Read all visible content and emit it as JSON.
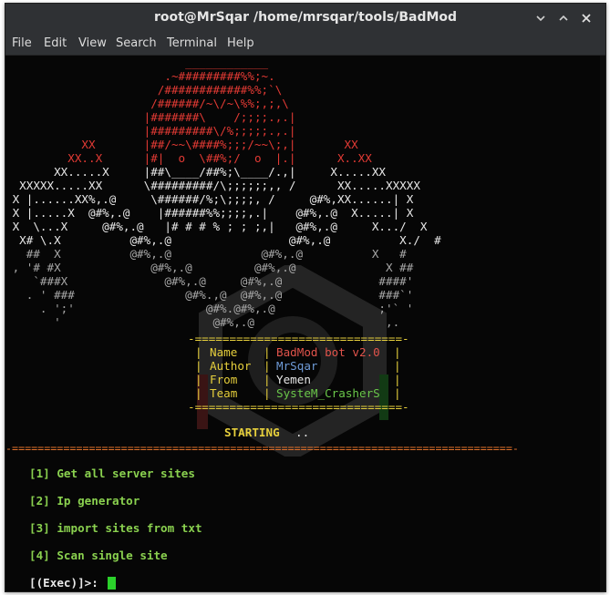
{
  "window": {
    "title": "root@MrSqar /home/mrsqar/tools/BadMod"
  },
  "menu": [
    "File",
    "Edit",
    "View",
    "Search",
    "Terminal",
    "Help"
  ],
  "art_lines": [
    "                          ____________",
    "                       .~#########%%;~.",
    "                      /############%%;`\\",
    "                     /######/~\\/~\\%%;,;,\\",
    "                    |#######\\    /;;;;.,.|",
    "                    |#########\\/%;;;;;.,.|",
    "           XX       |##/~~\\####%;;;/~~\\;,|       XX",
    "         XX..X      |#|  o  \\##%;/  o  |.|      X..XX",
    "       XX.....X     |##\\____/##%;\\____/.,|     X.....XX",
    "  XXXXX.....XX      \\#########/\\;;;;;;,, /      XX.....XXXXX",
    " X |......XX%,.@     \\######/%;\\;;;;, /     @#%,XX......| X",
    " X |.....X  @#%,.@    |######%%;;;;,.|    @#%,.@  X.....| X",
    " X  \\...X     @#%,.@   |# # # % ; ; ;,|   @#%,.@     X.../  X",
    "  X# \\.X          @#%,.@                 @#%,.@          X./  #",
    "   ##  X          @#%,.@             @#%,.@          X   #",
    " , '# #X             @#%,.@         @#%,.@             X ##",
    "    `###X              @#%,.@     @#%,.@              ####'",
    "   . ' ###                @#%.,@  @#%,.@              ###`'",
    "     . ';'                   @#%.@#%,.@               ;'` '",
    "       '                      @#%,.@                   ,."
  ],
  "info_box": {
    "border": "-==============================-",
    "rows": [
      {
        "label": "Name",
        "value": "BadMod bot v2.0"
      },
      {
        "label": "Author",
        "value": "MrSqar"
      },
      {
        "label": "From",
        "value": "Yemen"
      },
      {
        "label": "Team",
        "value": "SysteM_CrasherS"
      }
    ]
  },
  "starting_text": "STARTING",
  "starting_dots": "..",
  "separator": "-==============================================================================-",
  "options": [
    "[1] Get all server sites",
    "[2] Ip generator",
    "[3] import sites from txt",
    "[4] Scan single site"
  ],
  "prompt": "[(Exec)]>: ",
  "colors": {
    "art_red": "#e23a34",
    "label_yellow": "#e6cf3c",
    "team_green": "#6ac74a",
    "author_blue": "#6f9bd8",
    "option_green": "#8ad14f",
    "separator_orange": "#e0702a",
    "cursor_green": "#2bd12b"
  }
}
